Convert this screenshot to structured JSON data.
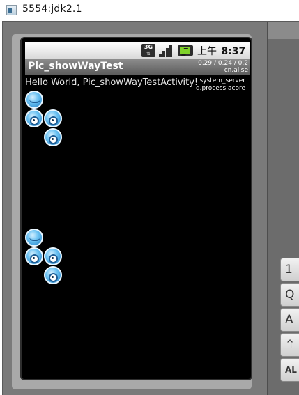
{
  "window": {
    "title": "5554:jdk2.1"
  },
  "status_bar": {
    "network_badge": "3G",
    "time_prefix": "上午",
    "time": "8:37",
    "icons": [
      "3g-icon",
      "signal-icon",
      "battery-icon"
    ]
  },
  "app": {
    "title": "Pic_showWayTest",
    "cpu_load": "0.29 / 0.24 / 0.2",
    "cpu_sub": "cn.alise",
    "hello_text": "Hello World, Pic_showWayTestActivity!",
    "process_1": "system_server",
    "process_2": "d.process.acore"
  },
  "keyboard": {
    "keys": [
      "1",
      "Q",
      "A",
      "⇧",
      "AL"
    ]
  },
  "images": {
    "groups": 2,
    "icon": "blob-character-icon"
  }
}
